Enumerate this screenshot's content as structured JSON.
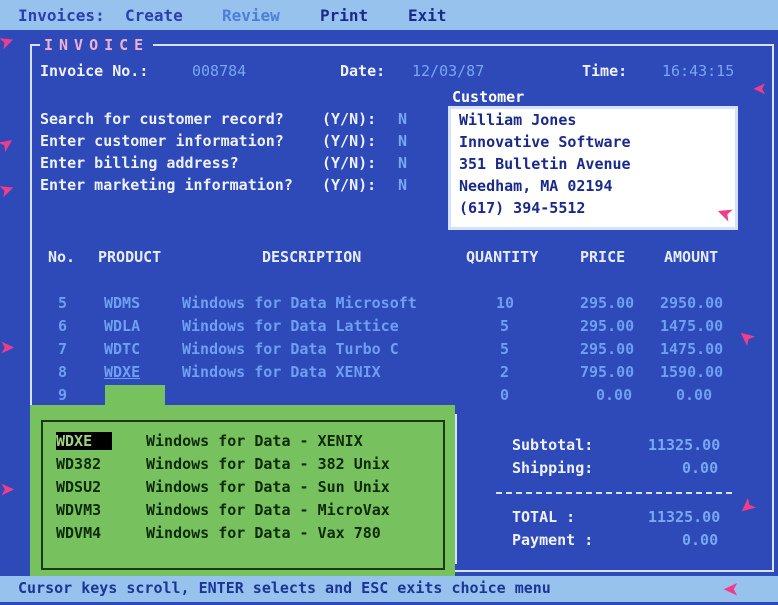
{
  "menu": [
    "Invoices:",
    "Create",
    "Review",
    "Print",
    "Exit"
  ],
  "form": {
    "title": "INVOICE",
    "invoice_label": "Invoice No.:",
    "invoice_no": "008784",
    "date_label": "Date:",
    "date": "12/03/87",
    "time_label": "Time:",
    "time": "16:43:15"
  },
  "questions": [
    {
      "text": "Search for customer record?",
      "yn": "(Y/N):",
      "answer": "N"
    },
    {
      "text": "Enter customer information?",
      "yn": "(Y/N):",
      "answer": "N"
    },
    {
      "text": "Enter billing address?",
      "yn": "(Y/N):",
      "answer": "N"
    },
    {
      "text": "Enter marketing information?",
      "yn": "(Y/N):",
      "answer": "N"
    }
  ],
  "customer": {
    "label": "Customer",
    "lines": [
      "William Jones",
      "Innovative Software",
      "351 Bulletin Avenue",
      "Needham, MA   02194",
      "(617) 394-5512"
    ]
  },
  "table": {
    "headers": [
      "No.",
      "PRODUCT",
      "DESCRIPTION",
      "QUANTITY",
      "PRICE",
      "AMOUNT"
    ],
    "rows": [
      {
        "no": "5",
        "product": "WDMS",
        "description": "Windows for Data  Microsoft",
        "qty": "10",
        "price": "295.00",
        "amount": "2950.00"
      },
      {
        "no": "6",
        "product": "WDLA",
        "description": "Windows for Data  Lattice",
        "qty": "5",
        "price": "295.00",
        "amount": "1475.00"
      },
      {
        "no": "7",
        "product": "WDTC",
        "description": "Windows for Data  Turbo C",
        "qty": "5",
        "price": "295.00",
        "amount": "1475.00"
      },
      {
        "no": "8",
        "product": "WDXE",
        "description": "Windows for Data  XENIX",
        "qty": "2",
        "price": "795.00",
        "amount": "1590.00"
      },
      {
        "no": "9",
        "product": "",
        "description": "",
        "qty": "0",
        "price": "0.00",
        "amount": "0.00"
      }
    ]
  },
  "choices": [
    {
      "code": "WDXE",
      "desc": "Windows for Data - XENIX"
    },
    {
      "code": "WD382",
      "desc": "Windows for Data - 382 Unix"
    },
    {
      "code": "WDSU2",
      "desc": "Windows for Data - Sun Unix"
    },
    {
      "code": "WDVM3",
      "desc": "Windows for Data - MicroVax"
    },
    {
      "code": "WDVM4",
      "desc": "Windows for Data - Vax 780"
    }
  ],
  "totals": {
    "subtotal_label": "Subtotal:",
    "subtotal": "11325.00",
    "shipping_label": "Shipping:",
    "shipping": "0.00",
    "total_label": "TOTAL   :",
    "total": "11325.00",
    "payment_label": "Payment :",
    "payment": "0.00"
  },
  "status": "Cursor keys scroll, ENTER selects and ESC exits choice menu",
  "colors": {
    "background": "#2e49b8",
    "menubar": "#98c2ee",
    "choice_panel": "#77c25e",
    "annotation_arrows": "#ee3d8a"
  }
}
